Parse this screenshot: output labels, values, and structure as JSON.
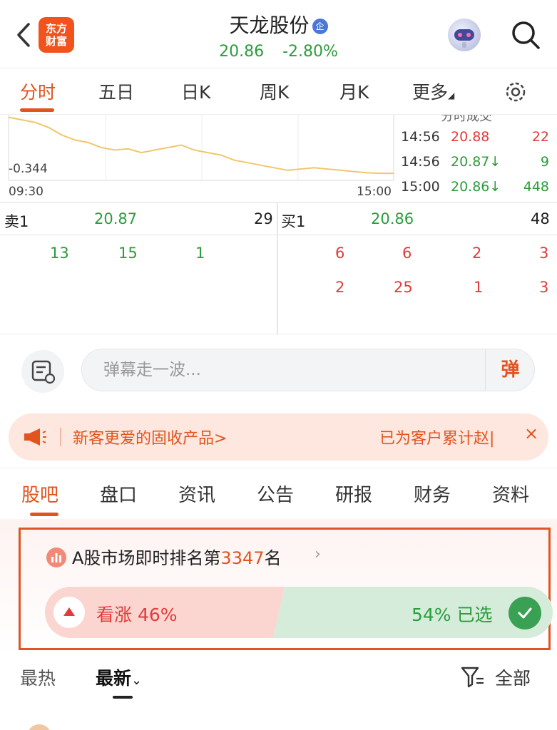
{
  "header": {
    "back_icon": "chevron-left-icon",
    "logo_line1": "东方",
    "logo_line2": "财富",
    "stock_name": "天龙股份",
    "badge": "企",
    "price": "20.86",
    "change_pct": "-2.80%",
    "robot_icon": "robot-avatar-icon",
    "search_icon": "search-icon"
  },
  "chart_tabs": [
    {
      "label": "分时",
      "active": true
    },
    {
      "label": "五日",
      "active": false
    },
    {
      "label": "日K",
      "active": false
    },
    {
      "label": "周K",
      "active": false
    },
    {
      "label": "月K",
      "active": false
    },
    {
      "label": "更多",
      "active": false
    }
  ],
  "chart": {
    "y_label": "-0.344",
    "x_start": "09:30",
    "x_end": "15:00",
    "line_color": "#f2c66b"
  },
  "chart_data": {
    "type": "line",
    "x_range": [
      "09:30",
      "15:00"
    ],
    "note_values_pct": [
      0.1,
      0.08,
      0.06,
      0.02,
      -0.04,
      -0.08,
      -0.1,
      -0.14,
      -0.16,
      -0.15,
      -0.18,
      -0.16,
      -0.14,
      -0.12,
      -0.16,
      -0.18,
      -0.2,
      -0.24,
      -0.26,
      -0.28,
      -0.3,
      -0.32,
      -0.31,
      -0.3,
      -0.31,
      -0.32,
      -0.33,
      -0.34,
      -0.344,
      -0.344
    ],
    "ylim": [
      -0.4,
      0.12
    ]
  },
  "trades": {
    "title": "分时成交",
    "rows": [
      {
        "time": "14:56",
        "price": "20.88",
        "vol": "22",
        "arrow": "",
        "vol_color": "red"
      },
      {
        "time": "14:56",
        "price": "20.87↓",
        "vol": "9",
        "arrow": "",
        "vol_color": "green"
      },
      {
        "time": "15:00",
        "price": "20.86↓",
        "vol": "448",
        "arrow": "",
        "vol_color": "green"
      }
    ]
  },
  "orderbook": {
    "sell_label": "卖1",
    "sell_price": "20.87",
    "sell_vol": "29",
    "buy_label": "买1",
    "buy_price": "20.86",
    "buy_vol": "48",
    "sell_details": [
      "13",
      "15",
      "1"
    ],
    "buy_details_row1": [
      "6",
      "6",
      "2",
      "3"
    ],
    "buy_details_row2": [
      "2",
      "25",
      "1",
      "3"
    ]
  },
  "danmaku": {
    "placeholder": "弹幕走一波...",
    "send_label": "弹",
    "settings_icon": "danmaku-settings-icon"
  },
  "promo": {
    "text": "新客更爱的固收产品>",
    "right_text": "已为客户累计赵|",
    "close": "×",
    "icon": "megaphone-icon"
  },
  "section_tabs": [
    {
      "label": "股吧",
      "active": true
    },
    {
      "label": "盘口",
      "active": false
    },
    {
      "label": "资讯",
      "active": false
    },
    {
      "label": "公告",
      "active": false
    },
    {
      "label": "研报",
      "active": false
    },
    {
      "label": "财务",
      "active": false
    },
    {
      "label": "资料",
      "active": false
    }
  ],
  "sentiment": {
    "rank_prefix": "A股市场即时排名第",
    "rank_number": "3347",
    "rank_suffix": "名",
    "up_label": "看涨 46%",
    "down_label": "54% 已选",
    "up_pct": 46,
    "down_pct": 54,
    "up_color": "#fbd6d0",
    "down_color": "#d6ecdb"
  },
  "sort": {
    "hot": "最热",
    "new": "最新",
    "filter": "全部"
  }
}
